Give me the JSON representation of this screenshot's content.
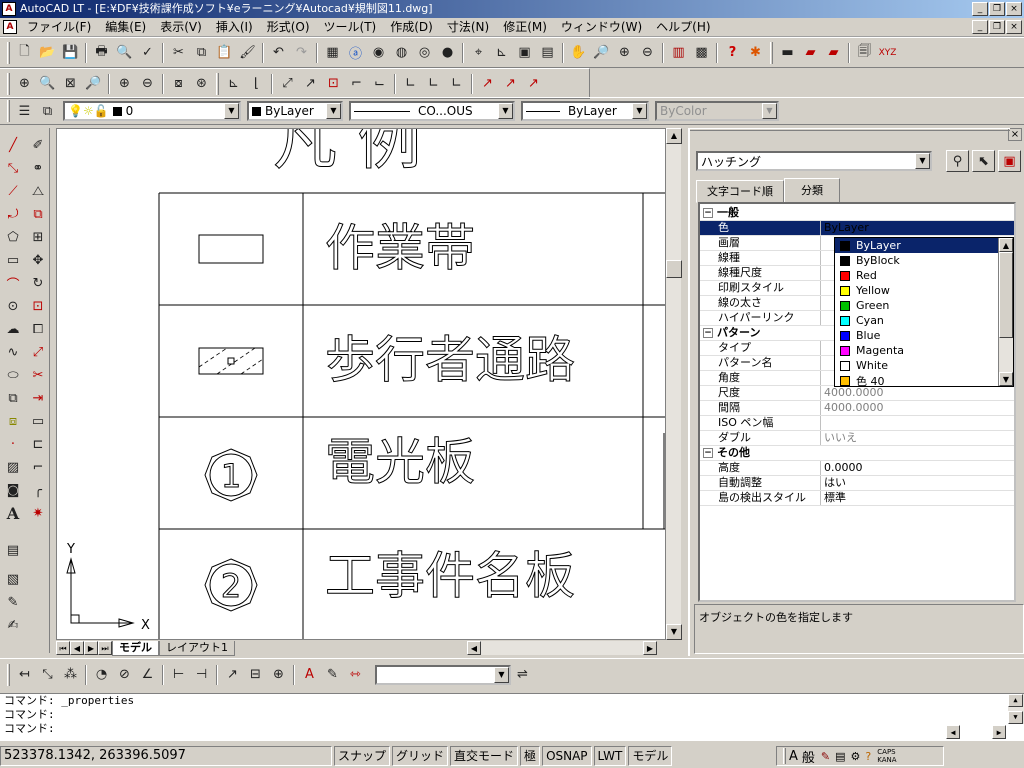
{
  "window": {
    "title": "AutoCAD LT - [E:¥DF¥技術課作成ソフト¥eラーニング¥Autocad¥規制図11.dwg]",
    "controls": [
      "_",
      "❐",
      "×"
    ]
  },
  "menu": [
    "ファイル(F)",
    "編集(E)",
    "表示(V)",
    "挿入(I)",
    "形式(O)",
    "ツール(T)",
    "作成(D)",
    "寸法(N)",
    "修正(M)",
    "ウィンドウ(W)",
    "ヘルプ(H)"
  ],
  "layers": {
    "current_layer": "0",
    "color": "ByLayer",
    "linetype": "CO...OUS",
    "lineweight": "ByLayer",
    "plotstyle": "ByColor"
  },
  "drawing": {
    "title_fragment": "凡 例",
    "rows": [
      {
        "label": "作業帯",
        "symbol": "rect"
      },
      {
        "label": "歩行者通路",
        "symbol": "hatched-rect"
      },
      {
        "label": "電光板",
        "symbol_text": "1"
      },
      {
        "label": "工事件名板",
        "symbol_text": "2"
      }
    ],
    "ucs": {
      "x_label": "X",
      "y_label": "Y"
    }
  },
  "model_tabs": [
    "モデル",
    "レイアウト1"
  ],
  "properties": {
    "object_type": "ハッチング",
    "tabs": [
      "文字コード順",
      "分類"
    ],
    "active_tab": "分類",
    "categories": [
      {
        "name": "一般",
        "rows": [
          {
            "name": "色",
            "value": "ByLayer",
            "selected": true
          },
          {
            "name": "画層",
            "value": ""
          },
          {
            "name": "線種",
            "value": ""
          },
          {
            "name": "線種尺度",
            "value": ""
          },
          {
            "name": "印刷スタイル",
            "value": ""
          },
          {
            "name": "線の太さ",
            "value": ""
          },
          {
            "name": "ハイパーリンク",
            "value": ""
          }
        ]
      },
      {
        "name": "パターン",
        "rows": [
          {
            "name": "タイプ",
            "value": ""
          },
          {
            "name": "パターン名",
            "value": ""
          },
          {
            "name": "角度",
            "value": ""
          },
          {
            "name": "尺度",
            "value": "4000.0000"
          },
          {
            "name": "間隔",
            "value": "4000.0000"
          },
          {
            "name": "ISO ペン幅",
            "value": ""
          },
          {
            "name": "ダブル",
            "value": "いいえ"
          }
        ]
      },
      {
        "name": "その他",
        "rows": [
          {
            "name": "高度",
            "value": "0.0000"
          },
          {
            "name": "自動調整",
            "value": "はい"
          },
          {
            "name": "島の検出スタイル",
            "value": "標準"
          }
        ]
      }
    ],
    "description": "オブジェクトの色を指定します",
    "color_options": [
      {
        "label": "ByLayer",
        "color": "#000000"
      },
      {
        "label": "ByBlock",
        "color": "#000000"
      },
      {
        "label": "Red",
        "color": "#ff0000"
      },
      {
        "label": "Yellow",
        "color": "#ffff00"
      },
      {
        "label": "Green",
        "color": "#00c000"
      },
      {
        "label": "Cyan",
        "color": "#00ffff"
      },
      {
        "label": "Blue",
        "color": "#0000ff"
      },
      {
        "label": "Magenta",
        "color": "#ff00ff"
      },
      {
        "label": "White",
        "color": "#ffffff"
      },
      {
        "label": "色 40",
        "color": "#ffbf00"
      }
    ]
  },
  "command_lines": [
    "コマンド: _properties",
    "コマンド:",
    "コマンド:"
  ],
  "status": {
    "coordinates": "523378.1342, 263396.5097",
    "toggles": [
      "スナップ",
      "グリッド",
      "直交モード",
      "極",
      "OSNAP",
      "LWT",
      "モデル"
    ],
    "ime": [
      "A",
      "般",
      "CAPS KANA"
    ]
  }
}
